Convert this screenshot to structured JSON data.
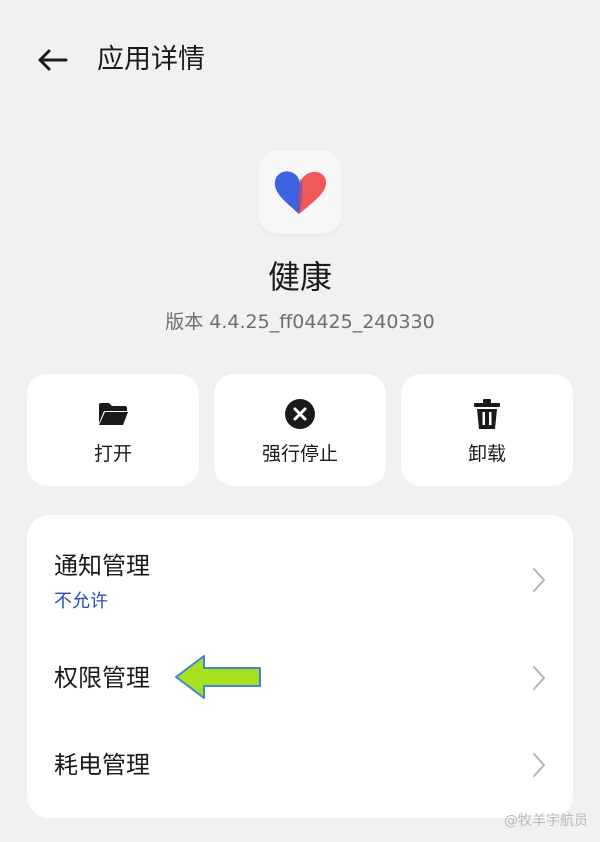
{
  "header": {
    "title": "应用详情",
    "back_icon": "arrow-left-icon"
  },
  "app": {
    "name": "健康",
    "version": "版本 4.4.25_ff04425_240330",
    "icon": "heart-icon",
    "icon_colors": {
      "blue": "#3d63e0",
      "red": "#f04a4a"
    }
  },
  "actions": [
    {
      "label": "打开",
      "icon": "folder-icon"
    },
    {
      "label": "强行停止",
      "icon": "close-circle-icon"
    },
    {
      "label": "卸载",
      "icon": "trash-icon"
    }
  ],
  "settings": [
    {
      "title": "通知管理",
      "subtitle": "不允许"
    },
    {
      "title": "权限管理"
    },
    {
      "title": "耗电管理"
    }
  ],
  "annotation": {
    "icon": "arrow-left-icon",
    "color": "#a6e01e"
  },
  "watermark": "@牧羊宇航员",
  "colors": {
    "background": "#f1f1f1",
    "card": "#ffffff",
    "accent_text": "#2c4bbf"
  }
}
